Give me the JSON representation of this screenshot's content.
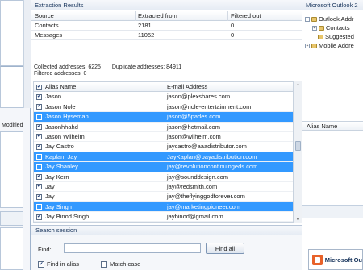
{
  "left": {
    "modified_label": "Modified"
  },
  "extraction": {
    "title": "Extraction Results",
    "columns": [
      "Source",
      "Extracted from",
      "Filtered out"
    ],
    "rows": [
      {
        "source": "Contacts",
        "extracted": "2181",
        "filtered": "0"
      },
      {
        "source": "Messages",
        "extracted": "11052",
        "filtered": "0"
      }
    ],
    "collected_label": "Collected addresses: 6225",
    "duplicate_label": "Duplicate addresses: 84911",
    "filtered_label": "Filtered addresses:   0"
  },
  "alias_list": {
    "col_alias": "Alias Name",
    "col_email": "E-mail Address",
    "rows": [
      {
        "alias": "Jason",
        "email": "jason@plexshares.com",
        "checked": true,
        "selected": false
      },
      {
        "alias": "Jason Nole",
        "email": "jason@nole-entertainment.com",
        "checked": true,
        "selected": false
      },
      {
        "alias": "Jason Hyseman",
        "email": "jason@5pades.com",
        "checked": false,
        "selected": true
      },
      {
        "alias": "Jasonhhahd",
        "email": "jason@hotmail.com",
        "checked": true,
        "selected": false
      },
      {
        "alias": "Jason Wilhelm",
        "email": "jason@wilhelm.com",
        "checked": true,
        "selected": false
      },
      {
        "alias": "Jay Castro",
        "email": "jaycastro@aaadistributor.com",
        "checked": true,
        "selected": false
      },
      {
        "alias": "Kaplan, Jay",
        "email": "JayKaplan@bayadistribution.com",
        "checked": false,
        "selected": true
      },
      {
        "alias": "Jay Shanley",
        "email": "jay@revolutioncontinuingeds.com",
        "checked": false,
        "selected": true
      },
      {
        "alias": "Jay Kern",
        "email": "jay@sounddesign.com",
        "checked": true,
        "selected": false
      },
      {
        "alias": "Jay",
        "email": "jay@redsmith.com",
        "checked": true,
        "selected": false
      },
      {
        "alias": "Jay",
        "email": "jay@theflyinggodforever.com",
        "checked": true,
        "selected": false
      },
      {
        "alias": "Jay Singh",
        "email": "jay@marketingpioneer.com",
        "checked": false,
        "selected": true
      },
      {
        "alias": "Jay Binod Singh",
        "email": "jaybinod@gmail.com",
        "checked": true,
        "selected": false
      }
    ]
  },
  "search": {
    "title": "Search session",
    "find_label": "Find:",
    "find_value": "",
    "find_button": "Find all",
    "opt_alias": "Find in alias",
    "opt_case": "Match case",
    "opt_alias_checked": true,
    "opt_case_checked": false
  },
  "right": {
    "title": "Microsoft Outlook 2",
    "tree": [
      "Outlook Addr",
      "Contacts",
      "Suggested",
      "Mobile Addre"
    ],
    "alias_header": "Alias Name",
    "badge": "Microsoft Ou"
  }
}
